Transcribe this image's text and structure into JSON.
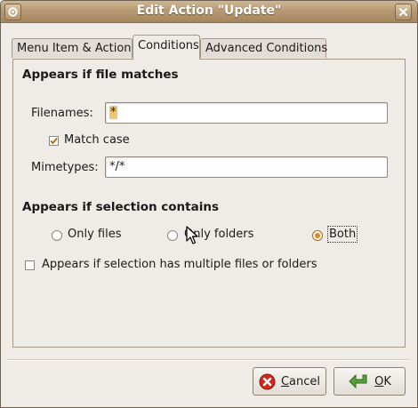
{
  "window": {
    "title": "Edit Action \"Update\""
  },
  "tabs": [
    {
      "label": "Menu Item & Action",
      "active": false
    },
    {
      "label": "Conditions",
      "active": true
    },
    {
      "label": "Advanced Conditions",
      "active": false
    }
  ],
  "file_matches": {
    "heading": "Appears if file matches",
    "filenames_label": "Filenames:",
    "filenames_value": "*",
    "match_case_label": "Match case",
    "match_case_checked": true,
    "mimetypes_label": "Mimetypes:",
    "mimetypes_value": "*/*"
  },
  "selection": {
    "heading": "Appears if selection contains",
    "options": [
      {
        "label": "Only files",
        "selected": false
      },
      {
        "label": "Only folders",
        "selected": false
      },
      {
        "label": "Both",
        "selected": true
      }
    ],
    "multiple_label": "Appears if selection has multiple files or folders",
    "multiple_checked": false
  },
  "buttons": {
    "cancel": {
      "mnemonic": "C",
      "rest": "ancel"
    },
    "ok": {
      "mnemonic": "O",
      "rest": "K"
    }
  },
  "colors": {
    "titlebar": "#b79a73",
    "accent": "#e08a1e",
    "selection": "#f1c66e"
  }
}
